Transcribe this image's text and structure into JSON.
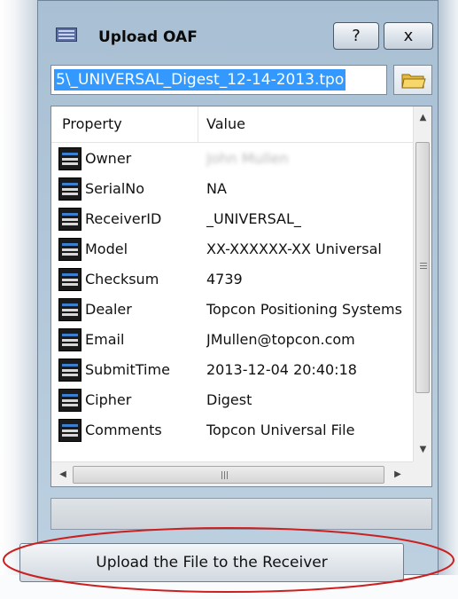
{
  "window": {
    "title": "Upload OAF",
    "help_label": "?",
    "close_label": "x"
  },
  "file": {
    "path": "5\\_UNIVERSAL_Digest_12-14-2013.tpo"
  },
  "grid": {
    "columns": [
      "Property",
      "Value"
    ],
    "rows": [
      {
        "property": "Owner",
        "value": "John Mullen",
        "blurred": true
      },
      {
        "property": "SerialNo",
        "value": "NA"
      },
      {
        "property": "ReceiverID",
        "value": "_UNIVERSAL_"
      },
      {
        "property": "Model",
        "value": "XX-XXXXXX-XX Universal"
      },
      {
        "property": "Checksum",
        "value": "4739"
      },
      {
        "property": "Dealer",
        "value": "Topcon Positioning Systems"
      },
      {
        "property": "Email",
        "value": "JMullen@topcon.com"
      },
      {
        "property": "SubmitTime",
        "value": "2013-12-04 20:40:18"
      },
      {
        "property": "Cipher",
        "value": "Digest"
      },
      {
        "property": "Comments",
        "value": "Topcon Universal File"
      }
    ]
  },
  "actions": {
    "upload_label": "Upload the File to the Receiver"
  },
  "colors": {
    "selection": "#3399ff",
    "annotation": "#cc1f1f"
  }
}
